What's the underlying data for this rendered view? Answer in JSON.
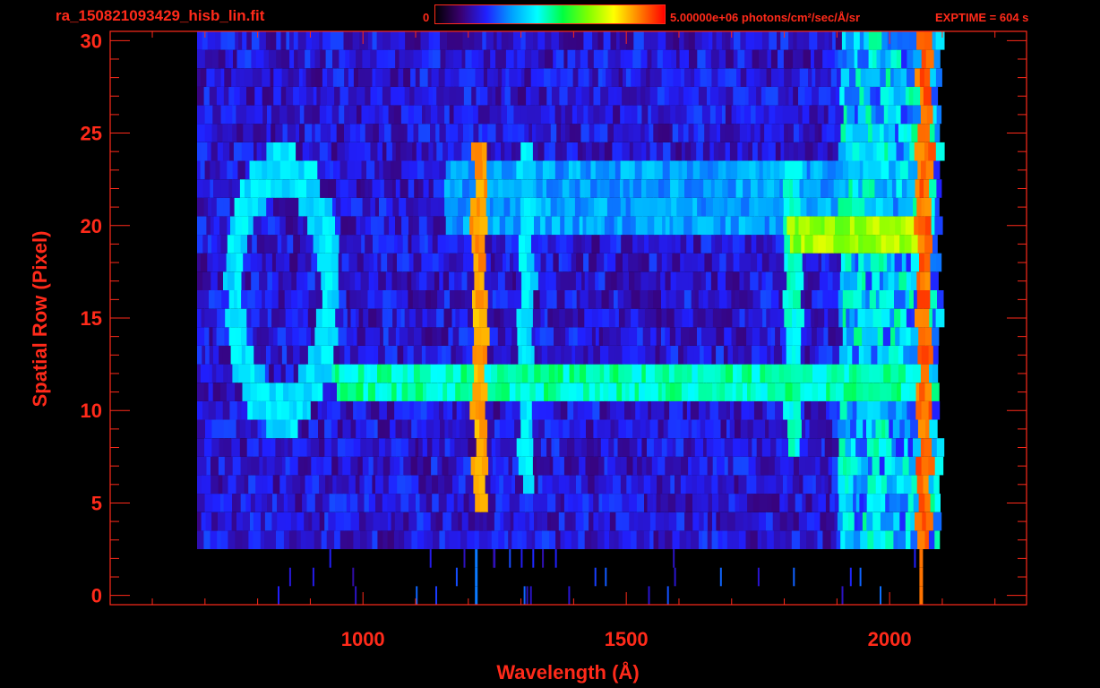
{
  "header": {
    "file_title": "ra_150821093429_hisb_lin.fit",
    "colorbar_min_label": "0",
    "colorbar_max_label": "5.00000e+06 photons/cm²/sec/Å/sr",
    "exptime_label": "EXPTIME = 604 s",
    "colorbar_colors": [
      "#000000",
      "#3a0070",
      "#2020ff",
      "#00a0ff",
      "#00ffff",
      "#00ff40",
      "#80ff00",
      "#ffff00",
      "#ff8000",
      "#ff0000"
    ]
  },
  "chart_data": {
    "type": "heatmap",
    "xlabel": "Wavelength (Å)",
    "ylabel": "Spatial Row (Pixel)",
    "xlim": [
      520,
      2260
    ],
    "ylim": [
      -0.5,
      30.5
    ],
    "xticks": [
      1000,
      1500,
      2000
    ],
    "yticks": [
      0,
      5,
      10,
      15,
      20,
      25,
      30
    ],
    "x_minor_step": 100,
    "y_minor_step": 1,
    "background_rows": [
      3,
      30
    ],
    "background_x_range": [
      685,
      2090
    ],
    "features": [
      {
        "kind": "emission_line",
        "wavelength": 1216,
        "rows": [
          5,
          24
        ],
        "level": 0.9
      },
      {
        "kind": "emission_line",
        "wavelength": 2060,
        "rows": [
          2,
          30
        ],
        "level": 0.95
      },
      {
        "kind": "emission_line",
        "wavelength": 1305,
        "rows": [
          6,
          24
        ],
        "level": 0.45
      },
      {
        "kind": "emission_line",
        "wavelength": 1810,
        "rows": [
          8,
          23
        ],
        "level": 0.5
      },
      {
        "kind": "band",
        "rows": [
          11,
          12
        ],
        "x_range": [
          940,
          2060
        ],
        "level": 0.55
      },
      {
        "kind": "band",
        "rows": [
          19,
          20
        ],
        "x_range": [
          1800,
          2060
        ],
        "level": 0.75
      },
      {
        "kind": "band",
        "rows": [
          20,
          23
        ],
        "x_range": [
          1150,
          2060
        ],
        "level": 0.4
      },
      {
        "kind": "ring",
        "center_wavelength": 840,
        "center_row": 16.5,
        "radius_wavelength": 90,
        "radius_rows": 6.5,
        "level": 0.45
      }
    ]
  }
}
